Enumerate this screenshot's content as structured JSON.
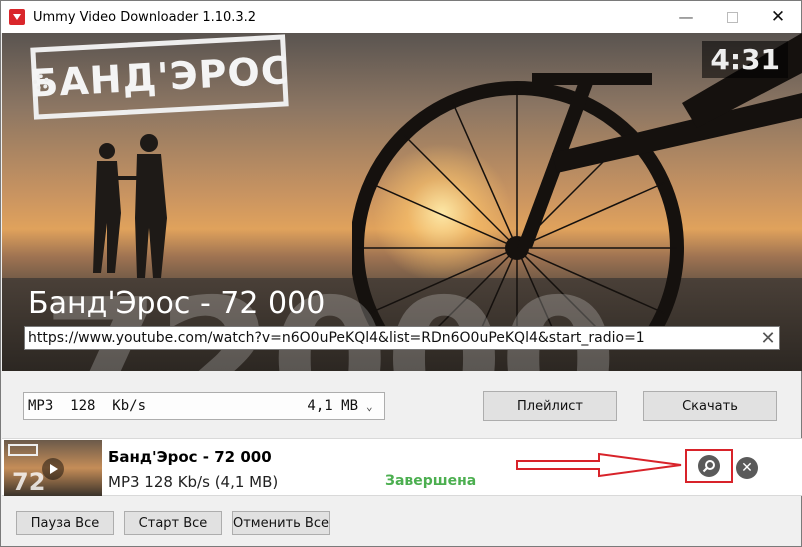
{
  "window": {
    "title": "Ummy Video Downloader 1.10.3.2"
  },
  "video": {
    "logo": "БАНД'ЭРОС",
    "duration": "4:31",
    "title": "Банд'Эрос - 72 000",
    "watermark": "72000"
  },
  "url_field": {
    "value": "https://www.youtube.com/watch?v=n6O0uPeKQl4&list=RDn6O0uPeKQl4&start_radio=1"
  },
  "format": {
    "label": "MP3  128  Kb/s",
    "size": "4,1 MB"
  },
  "buttons": {
    "playlist": "Плейлист",
    "download": "Скачать",
    "pause_all": "Пауза Все",
    "start_all": "Старт Все",
    "cancel_all": "Отменить Все"
  },
  "downloads": [
    {
      "title": "Банд'Эрос - 72 000",
      "info": "MP3  128  Kb/s (4,1 MB)",
      "status": "Завершена",
      "thumb_text": "72 000"
    }
  ],
  "colors": {
    "status_done": "#4caf50",
    "annotation_red": "#d8232a",
    "brand_red": "#d9262b"
  },
  "icons": {
    "app": "download-icon",
    "clear": "close-icon",
    "dropdown": "chevron-down-icon",
    "open_folder": "search-icon",
    "remove": "remove-icon"
  }
}
